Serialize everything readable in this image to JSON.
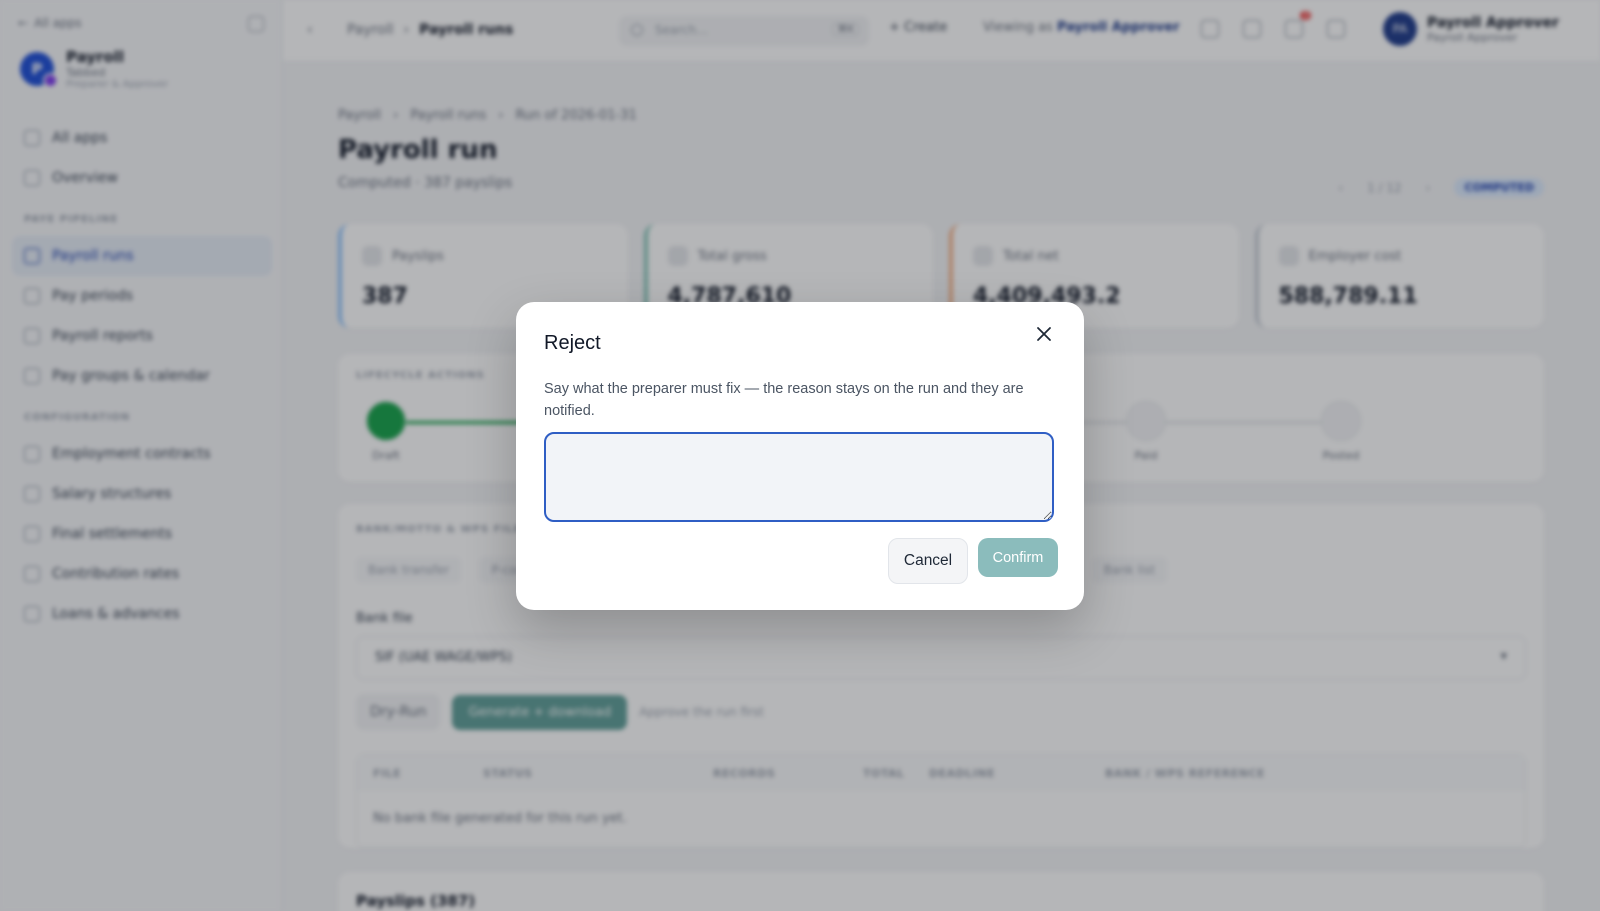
{
  "sidebar": {
    "back_label": "All apps",
    "brand": {
      "logo_letter": "P",
      "name": "Payroll",
      "sub": "Tabbed",
      "tag": "Preparer & Approver"
    },
    "items_top": [
      {
        "label": "All apps"
      },
      {
        "label": "Overview"
      }
    ],
    "section1": "PAYE PIPELINE",
    "items_pipeline": [
      {
        "label": "Payroll runs",
        "active": true
      },
      {
        "label": "Pay periods"
      },
      {
        "label": "Payroll reports"
      },
      {
        "label": "Pay groups & calendar"
      }
    ],
    "section2": "CONFIGURATION",
    "items_config": [
      {
        "label": "Employment contracts"
      },
      {
        "label": "Salary structures"
      },
      {
        "label": "Final settlements"
      },
      {
        "label": "Contribution rates"
      },
      {
        "label": "Loans & advances"
      }
    ]
  },
  "topbar": {
    "crumb_root": "Payroll",
    "crumb_current": "Payroll runs",
    "search_placeholder": "Search…",
    "search_kbd": "⌘K",
    "create_label": "+ Create",
    "viewing_prefix": "Viewing as",
    "viewing_role": "Payroll Approver",
    "user_initials": "PA",
    "user_name": "Payroll Approver",
    "user_role": "Payroll Approver"
  },
  "main": {
    "crumbs": [
      "Payroll",
      "Payroll runs",
      "Run of 2026-01-31"
    ],
    "title": "Payroll run",
    "subtitle": "Computed · 387 payslips",
    "pager": [
      "‹",
      "1 / 12",
      "›"
    ],
    "status": "COMPUTED",
    "stats": [
      {
        "label": "Payslips",
        "value": "387",
        "accent": "#93c5fd"
      },
      {
        "label": "Total gross",
        "value": "4,787,610",
        "accent": "#86c5b9"
      },
      {
        "label": "Total net",
        "value": "4,409,493.2",
        "accent": "#f6b38a"
      },
      {
        "label": "Employer cost",
        "value": "588,789.11",
        "accent": "#c7cdd6"
      }
    ],
    "lifecycle_caption": "LIFECYCLE ACTIONS",
    "steps": [
      {
        "label": "Draft",
        "done": true
      },
      {
        "label": "Paid",
        "done": false
      },
      {
        "label": "Posted",
        "done": false
      }
    ],
    "bank_caption": "BANK/MOTTO & WPS FILES",
    "tabs": [
      "Bank transfer",
      "P-code",
      "Bank list"
    ],
    "field_label": "Bank file",
    "field_value": "SIF (UAE WAGE/WPS)",
    "btn_preview": "Dry-Run",
    "btn_generate": "Generate + download",
    "hint": "Approve the run first",
    "table_headers": [
      "FILE",
      "STATUS",
      "RECORDS",
      "TOTAL",
      "DEADLINE",
      "BANK / WPS REFERENCE"
    ],
    "table_empty": "No bank file generated for this run yet.",
    "payslips_title": "Payslips (387)"
  },
  "dialog": {
    "title": "Reject",
    "description": "Say what the preparer must fix — the reason stays on the run and they are notified.",
    "reason_value": "",
    "reason_placeholder": "",
    "cancel_label": "Cancel",
    "confirm_label": "Confirm",
    "accent": "#2f5ec4",
    "confirm_color": "#8bbcbc"
  }
}
